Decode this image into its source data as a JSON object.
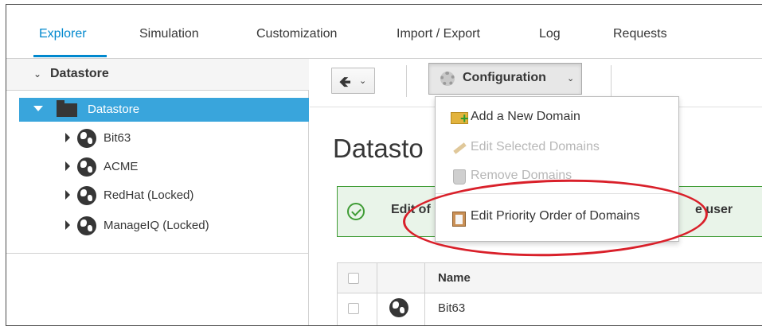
{
  "nav": {
    "tabs": [
      {
        "label": "Explorer",
        "active": true
      },
      {
        "label": "Simulation"
      },
      {
        "label": "Customization"
      },
      {
        "label": "Import / Export"
      },
      {
        "label": "Log"
      },
      {
        "label": "Requests"
      }
    ]
  },
  "sidebar": {
    "accordion_title": "Datastore",
    "tree": {
      "root": "Datastore",
      "items": [
        {
          "label": "Bit63"
        },
        {
          "label": "ACME"
        },
        {
          "label": "RedHat (Locked)"
        },
        {
          "label": "ManageIQ (Locked)"
        }
      ]
    }
  },
  "toolbar": {
    "config_label": "Configuration"
  },
  "main": {
    "title": "Datasto",
    "alert_text_start": "Edit of",
    "alert_text_end": "e user"
  },
  "table": {
    "columns": [
      "Name"
    ],
    "rows": [
      {
        "name": "Bit63"
      }
    ]
  },
  "dropdown": {
    "items": [
      {
        "label": "Add a New Domain",
        "enabled": true
      },
      {
        "label": "Edit Selected Domains",
        "enabled": false
      },
      {
        "label": "Remove Domains",
        "enabled": false
      },
      {
        "label": "Edit Priority Order of Domains",
        "enabled": true
      }
    ]
  },
  "colors": {
    "accent": "#0088ce",
    "tree_selected": "#39a5dc",
    "success": "#3f9c35",
    "annotation": "#d9202a"
  }
}
